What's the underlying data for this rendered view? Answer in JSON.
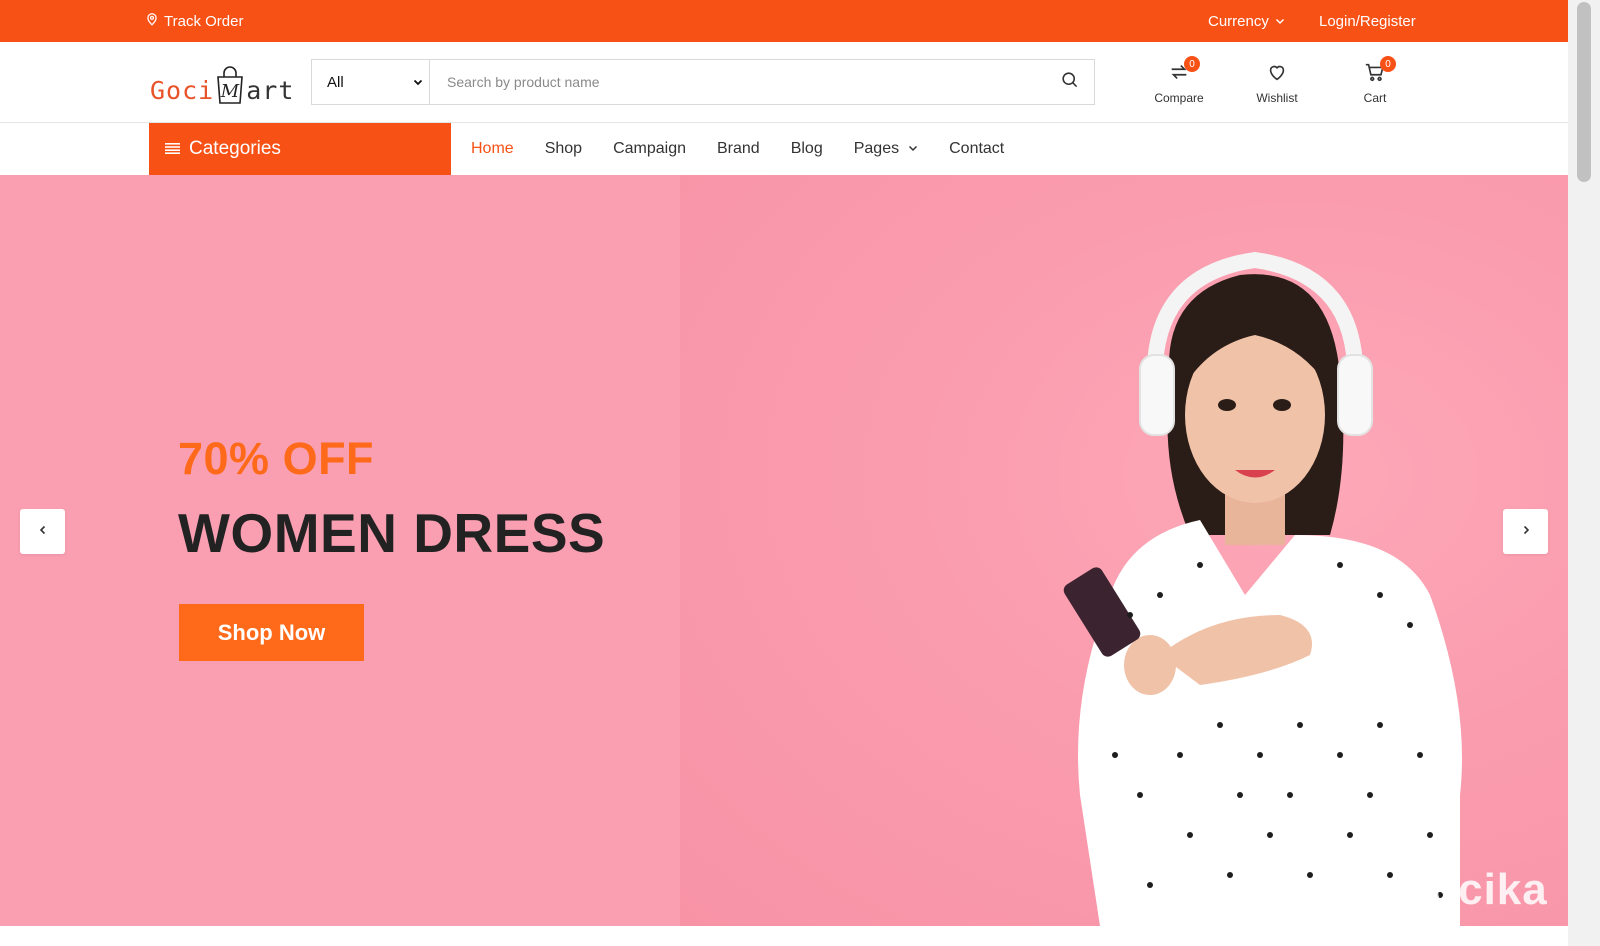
{
  "topbar": {
    "track_order": "Track Order",
    "currency": "Currency",
    "login_register": "Login/Register"
  },
  "brand": {
    "logo_part1": "Goci",
    "logo_part2": "art",
    "logo_bag_letter": "M",
    "brand_color": "#f75116"
  },
  "search": {
    "category_selected": "All",
    "placeholder": "Search by product name",
    "value": ""
  },
  "header_actions": {
    "compare": {
      "label": "Compare",
      "count": "0",
      "icon": "compare-icon"
    },
    "wishlist": {
      "label": "Wishlist",
      "icon": "heart-icon"
    },
    "cart": {
      "label": "Cart",
      "count": "0",
      "icon": "cart-icon"
    }
  },
  "nav": {
    "categories_label": "Categories",
    "items": [
      {
        "label": "Home",
        "active": true
      },
      {
        "label": "Shop"
      },
      {
        "label": "Campaign"
      },
      {
        "label": "Brand"
      },
      {
        "label": "Blog"
      },
      {
        "label": "Pages",
        "has_dropdown": true
      },
      {
        "label": "Contact"
      }
    ]
  },
  "hero": {
    "discount": "70% OFF",
    "headline": "WOMEN DRESS",
    "cta": "Shop Now",
    "watermark": "Gocika",
    "background_color": "#fa9fb1",
    "accent_color": "#fe6a1a"
  }
}
